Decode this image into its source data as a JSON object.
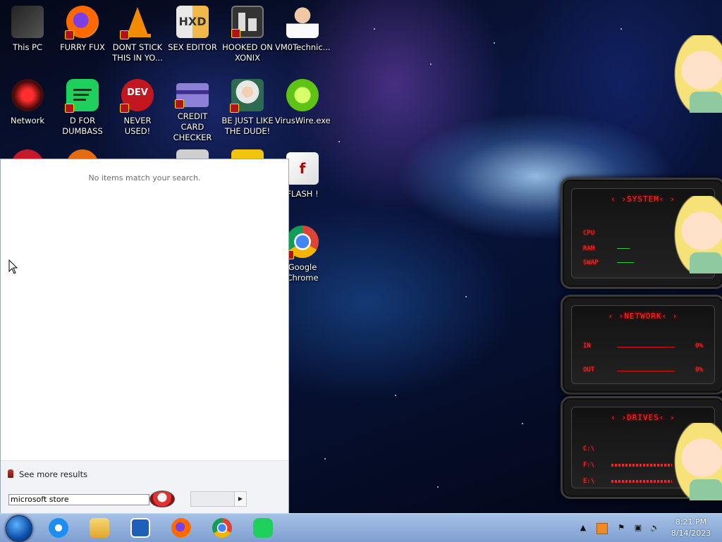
{
  "desktop": {
    "icons": [
      {
        "label": "This PC"
      },
      {
        "label": "FURRY FUX"
      },
      {
        "label": "DONT STICK THIS IN YO..."
      },
      {
        "label": "SEX EDITOR"
      },
      {
        "label": "HOOKED ON XONIX"
      },
      {
        "label": "VM0Technic..."
      },
      {
        "label": "Network"
      },
      {
        "label": "D FOR DUMBASS"
      },
      {
        "label": "NEVER USED!"
      },
      {
        "label": "CREDIT CARD CHECKER"
      },
      {
        "label": "BE JUST LIKE THE DUDE!"
      },
      {
        "label": "VirusWire.exe"
      },
      {
        "label": "FLASH !"
      },
      {
        "label": "Google Chrome"
      }
    ],
    "icon_badges": {
      "dev": "DEV",
      "hxd": "HXD"
    }
  },
  "start_menu": {
    "no_items_text": "No items match your search.",
    "see_more_label": "See more results",
    "search_value": "microsoft store"
  },
  "gadgets": {
    "system": {
      "title": "SYSTEM",
      "rows": [
        {
          "label": "CPU"
        },
        {
          "label": "RAM"
        },
        {
          "label": "SWAP"
        }
      ]
    },
    "network": {
      "title": "NETWORK",
      "rows": [
        {
          "label": "IN",
          "value": "0%"
        },
        {
          "label": "OUT",
          "value": "0%"
        }
      ]
    },
    "drives": {
      "title": "DRIVES",
      "rows": [
        {
          "label": "C:\\",
          "value": "2"
        },
        {
          "label": "F:\\",
          "value": "1"
        },
        {
          "label": "E:\\",
          "value": "1"
        }
      ]
    }
  },
  "taskbar": {
    "pinned": [
      "start-orb",
      "internet-explorer-icon",
      "file-explorer-icon",
      "mail-icon",
      "firefox-icon",
      "chrome-icon",
      "spotify-like-icon"
    ],
    "clock_time": "8:21 PM",
    "clock_date": "8/14/2023"
  },
  "colors": {
    "gadget_accent": "#ff2a2a",
    "taskbar": "#8eaede",
    "start_menu_bg": "#ffffff"
  }
}
